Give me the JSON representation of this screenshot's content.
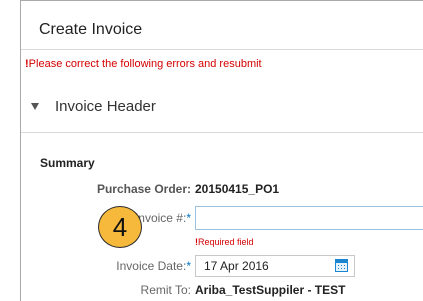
{
  "page": {
    "title": "Create Invoice"
  },
  "error_banner": {
    "mark": "!",
    "text": "Please correct the following errors and resubmit"
  },
  "section": {
    "title": "Invoice Header"
  },
  "summary": {
    "title": "Summary",
    "purchase_order": {
      "label": "Purchase Order:",
      "value": "20150415_PO1"
    },
    "invoice_number": {
      "label": "Invoice #:",
      "required": "*",
      "value": "",
      "error_mark": "!",
      "error": "Required field"
    },
    "invoice_date": {
      "label": "Invoice Date:",
      "required": "*",
      "value": "17 Apr 2016"
    },
    "remit_to": {
      "label": "Remit To:",
      "value": "Ariba_TestSuppiler - TEST"
    }
  },
  "step_badge": {
    "number": "4"
  },
  "colors": {
    "error": "#d40000",
    "badge": "#f6b93b",
    "required": "#0072c6"
  }
}
